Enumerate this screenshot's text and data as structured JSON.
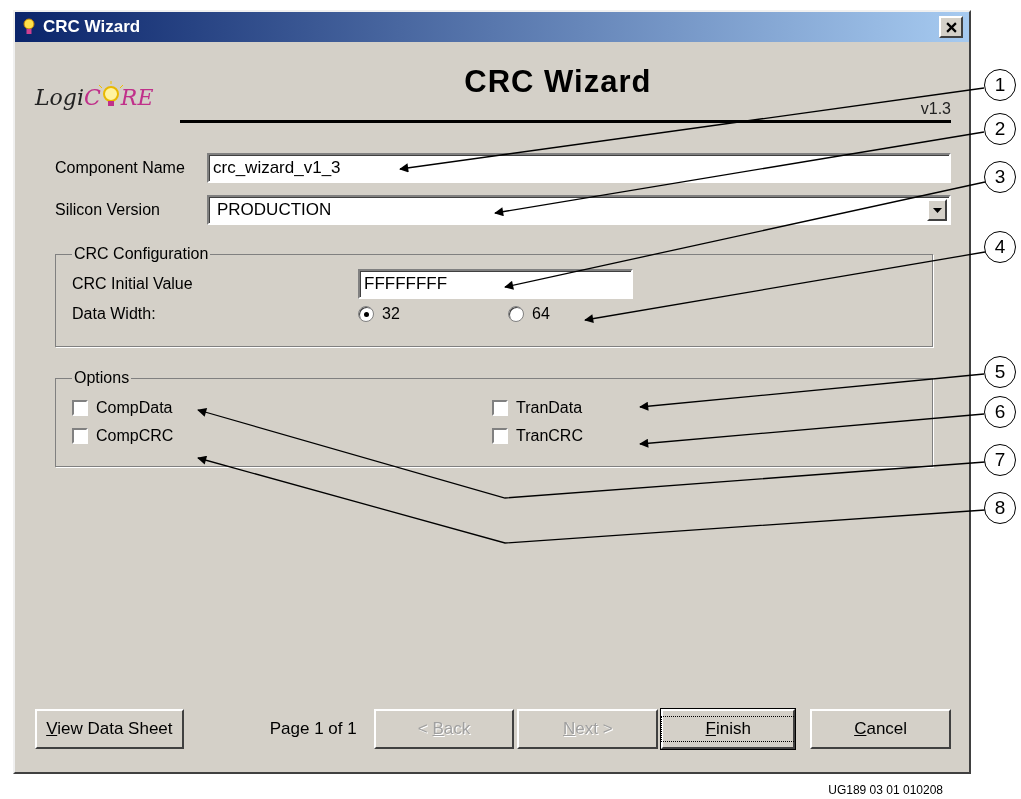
{
  "window": {
    "title": "CRC Wizard"
  },
  "header": {
    "logo": {
      "lead": "Logi",
      "mid": "C",
      "tail": "RE"
    },
    "title": "CRC Wizard",
    "version": "v1.3"
  },
  "fields": [
    {
      "kind": "text",
      "label": "Component Name",
      "value": "crc_wizard_v1_3"
    },
    {
      "kind": "select",
      "label": "Silicon Version",
      "value": "PRODUCTION"
    }
  ],
  "crc_configuration": {
    "title": "CRC Configuration",
    "initial_value": {
      "label": "CRC Initial Value",
      "value": "FFFFFFFF"
    },
    "data_width": {
      "label": "Data Width:",
      "options": [
        {
          "label": "32",
          "selected": true
        },
        {
          "label": "64",
          "selected": false
        }
      ]
    }
  },
  "options": {
    "title": "Options",
    "items": [
      {
        "label": "CompData",
        "checked": false
      },
      {
        "label": "TranData",
        "checked": false
      },
      {
        "label": "CompCRC",
        "checked": false
      },
      {
        "label": "TranCRC",
        "checked": false
      }
    ]
  },
  "footer": {
    "page_info": "Page 1 of 1",
    "buttons": [
      {
        "label": {
          "key": "V",
          "after": "iew Data Sheet"
        },
        "disabled": false,
        "default": false
      },
      {
        "label": {
          "before": "< ",
          "key": "B",
          "after": "ack"
        },
        "disabled": true,
        "default": false
      },
      {
        "label": {
          "key": "N",
          "after": "ext >"
        },
        "disabled": true,
        "default": false
      },
      {
        "label": {
          "key": "F",
          "after": "inish"
        },
        "disabled": false,
        "default": true
      },
      {
        "label": {
          "key": "C",
          "after": "ancel"
        },
        "disabled": false,
        "default": false
      }
    ]
  },
  "callouts": [
    {
      "number": "1"
    },
    {
      "number": "2"
    },
    {
      "number": "3"
    },
    {
      "number": "4"
    },
    {
      "number": "5"
    },
    {
      "number": "6"
    },
    {
      "number": "7"
    },
    {
      "number": "8"
    }
  ],
  "figure_id": "UG189 03 01 010208"
}
